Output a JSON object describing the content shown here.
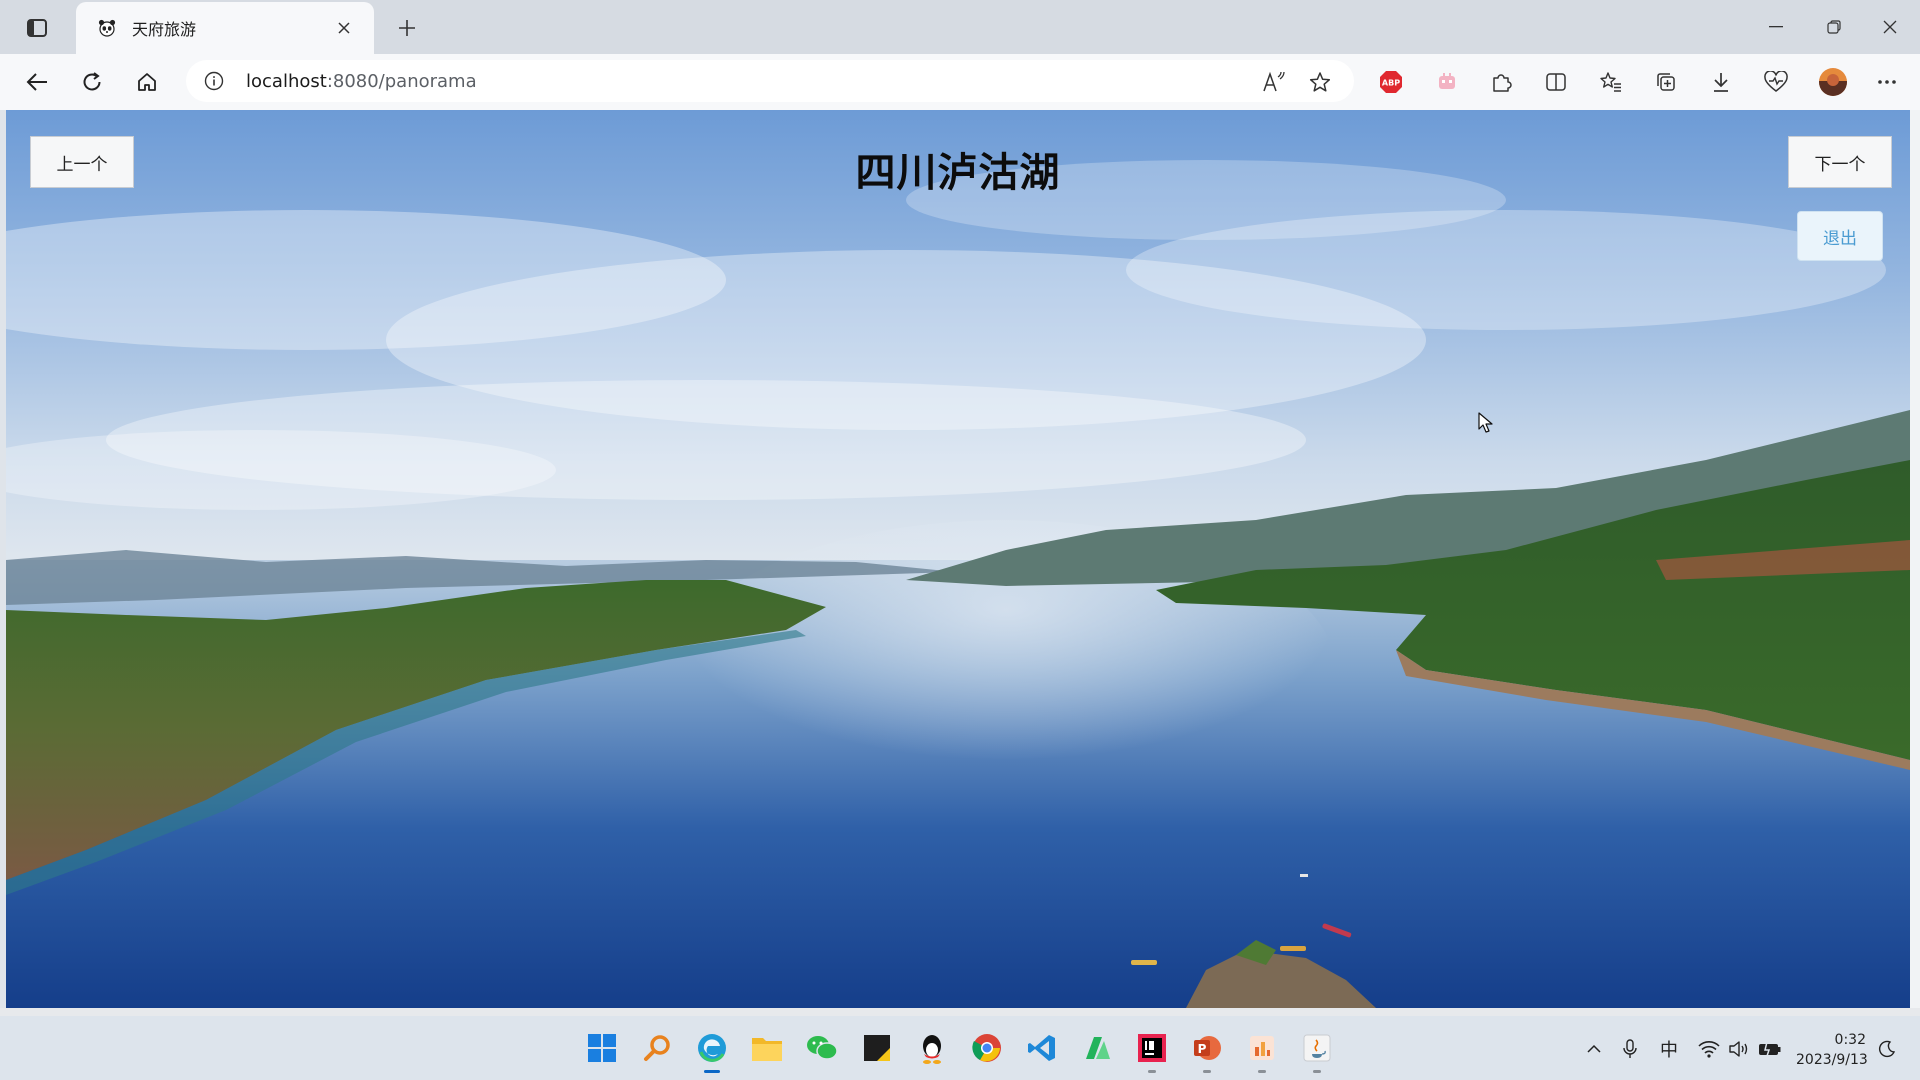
{
  "browser": {
    "tab": {
      "title": "天府旅游"
    },
    "address": {
      "host": "localhost",
      "rest": ":8080/panorama"
    }
  },
  "page": {
    "title": "四川泸沽湖",
    "prev_label": "上一个",
    "next_label": "下一个",
    "exit_label": "退出"
  },
  "taskbar": {
    "apps": [
      "start-icon",
      "search-icon",
      "edge-icon",
      "file-explorer-icon",
      "wechat-icon",
      "notes-icon",
      "qq-icon",
      "chrome-icon",
      "vscode-icon",
      "app-icon",
      "intellij-icon",
      "powerpoint-icon",
      "app-icon",
      "java-icon"
    ],
    "ime": "中",
    "time": "0:32",
    "date": "2023/9/13"
  }
}
